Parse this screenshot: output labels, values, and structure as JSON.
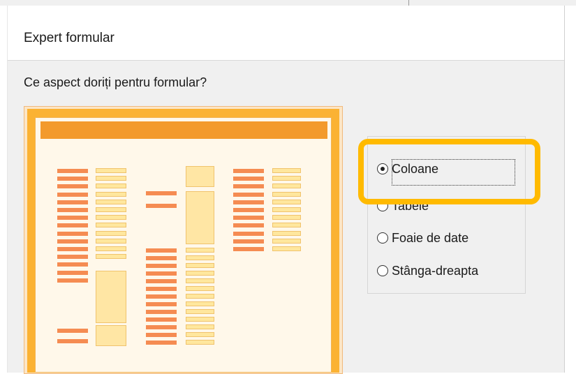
{
  "dialog": {
    "title": "Expert formular",
    "question": "Ce aspect doriți pentru formular?"
  },
  "layout_options": [
    {
      "label": "Coloane",
      "selected": true
    },
    {
      "label": "Tabele",
      "selected": false
    },
    {
      "label": "Foaie de date",
      "selected": false
    },
    {
      "label": "Stânga-dreapta",
      "selected": false
    }
  ],
  "colors": {
    "highlight": "#ffba00",
    "preview_frame": "#fbb233",
    "preview_header": "#f39a2c",
    "preview_label": "#f58c52",
    "preview_field": "#ffe79e"
  }
}
